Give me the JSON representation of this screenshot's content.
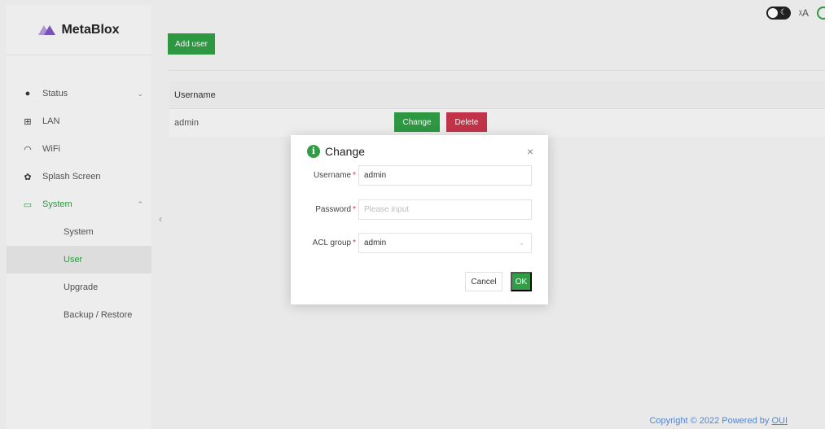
{
  "app": {
    "logo_text": "MetaBlox",
    "accent_color": "#2f9e44",
    "danger_color": "#c9364b"
  },
  "sidebar": {
    "items": [
      {
        "label": "Status",
        "icon": "info-circle-icon"
      },
      {
        "label": "LAN",
        "icon": "network-icon"
      },
      {
        "label": "WiFi",
        "icon": "wifi-icon"
      },
      {
        "label": "Splash Screen",
        "icon": "gear-icon"
      },
      {
        "label": "System",
        "icon": "monitor-icon"
      }
    ],
    "sub_items": [
      "System",
      "User",
      "Upgrade",
      "Backup / Restore"
    ],
    "selected_sub_item": "User"
  },
  "toolbar": {
    "add_user_label": "Add user"
  },
  "table": {
    "columns": [
      "Username"
    ],
    "rows": [
      {
        "username": "admin",
        "change_label": "Change",
        "delete_label": "Delete"
      }
    ]
  },
  "modal": {
    "title": "Change",
    "close_glyph": "×",
    "fields": {
      "username": {
        "label": "Username",
        "value": "admin"
      },
      "password": {
        "label": "Password",
        "placeholder": "Please input"
      },
      "acl_group": {
        "label": "ACL group",
        "value": "admin"
      }
    },
    "required_mark": "*",
    "cancel_label": "Cancel",
    "ok_label": "OK"
  },
  "footer": {
    "text": "Copyright © 2022 Powered by",
    "link": "OUI"
  },
  "topbar": {
    "theme_toggle_icon": "moon-icon",
    "language_icon": "translate-icon",
    "refresh_icon": "refresh-icon"
  }
}
